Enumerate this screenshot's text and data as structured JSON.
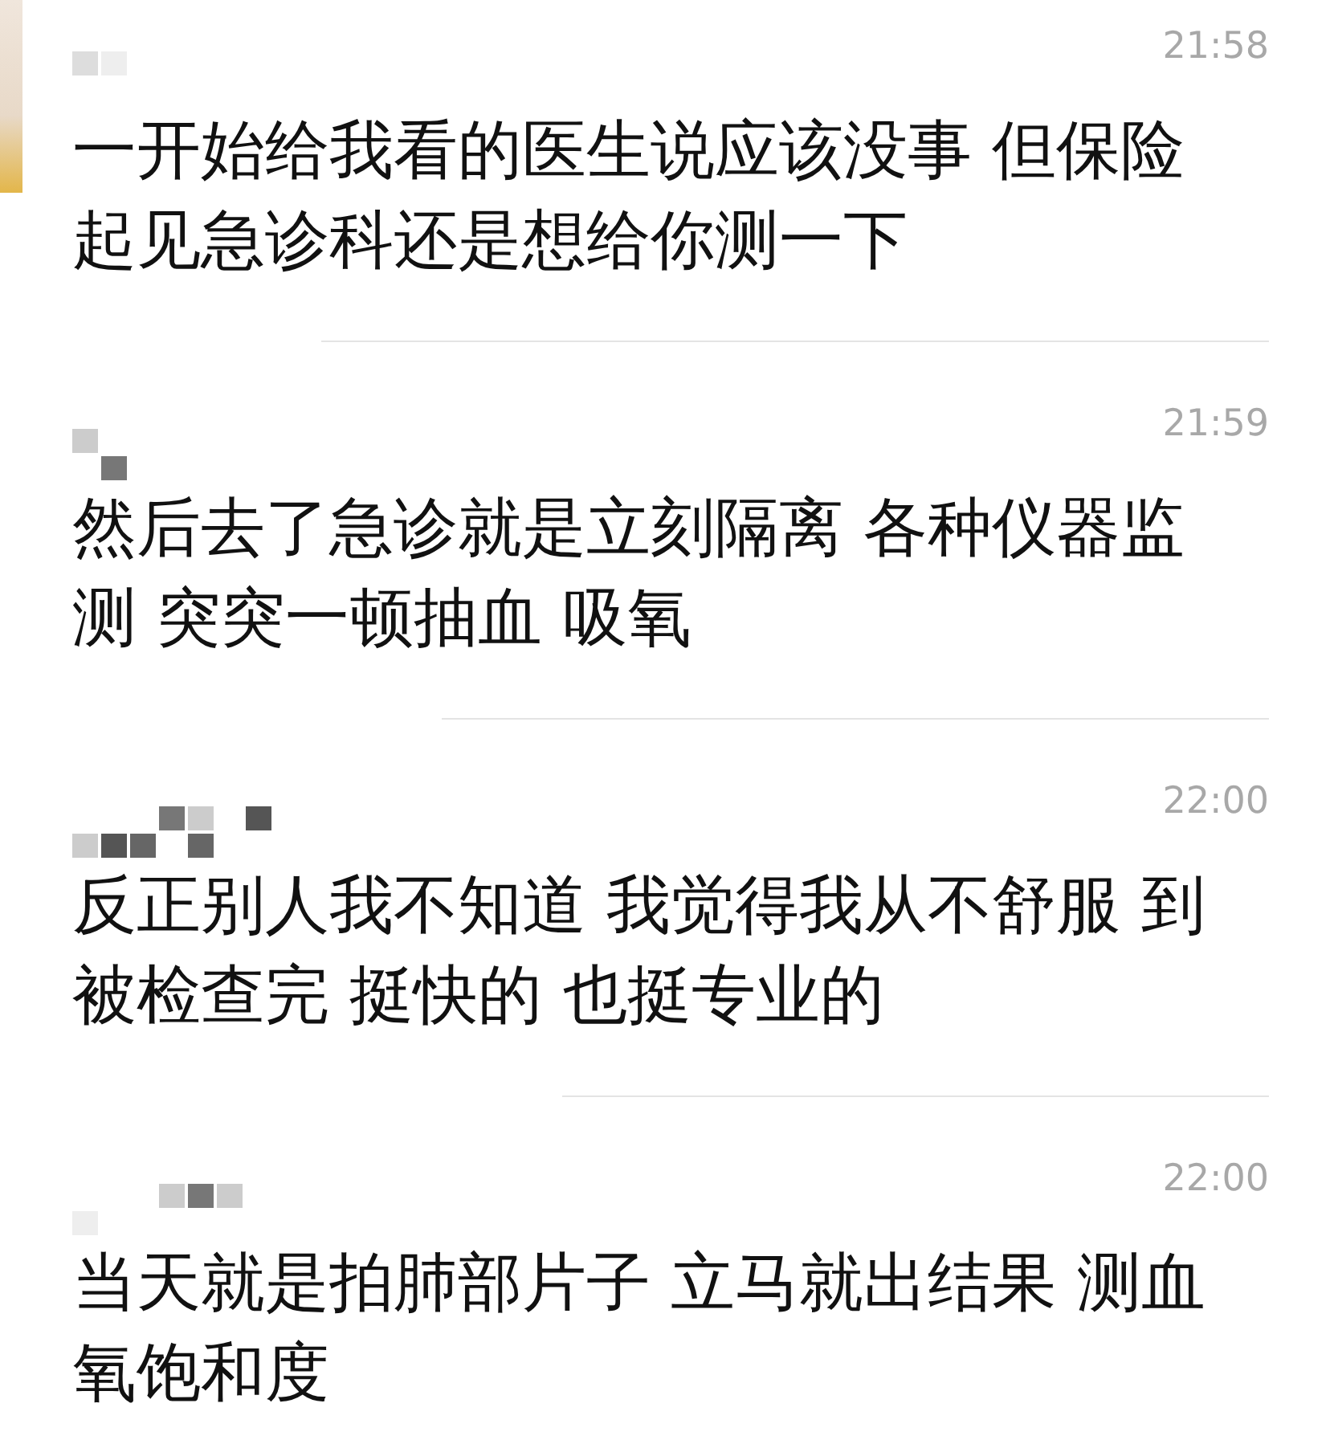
{
  "messages": [
    {
      "time": "21:58",
      "text": "一开始给我看的医生说应该没事 但保险起见急诊科还是想给你测一下"
    },
    {
      "time": "21:59",
      "text": "然后去了急诊就是立刻隔离 各种仪器监测 突突一顿抽血 吸氧"
    },
    {
      "time": "22:00",
      "text": "反正别人我不知道 我觉得我从不舒服 到被检查完 挺快的 也挺专业的"
    },
    {
      "time": "22:00",
      "text": "当天就是拍肺部片子 立马就出结果 测血氧饱和度"
    }
  ]
}
